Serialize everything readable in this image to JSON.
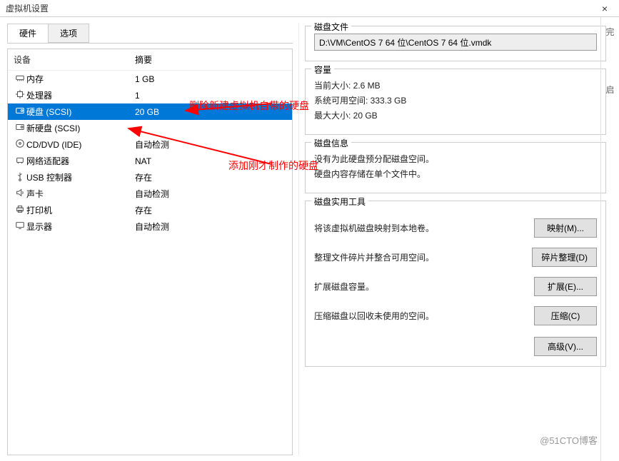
{
  "window": {
    "title": "虚拟机设置",
    "close_icon": "×"
  },
  "tabs": {
    "hardware": "硬件",
    "options": "选项"
  },
  "device_headers": {
    "device": "设备",
    "summary": "摘要"
  },
  "devices": [
    {
      "name": "内存",
      "summary": "1 GB",
      "icon": "memory"
    },
    {
      "name": "处理器",
      "summary": "1",
      "icon": "cpu"
    },
    {
      "name": "硬盘 (SCSI)",
      "summary": "20 GB",
      "icon": "disk",
      "selected": true
    },
    {
      "name": "新硬盘 (SCSI)",
      "summary": "",
      "icon": "disk"
    },
    {
      "name": "CD/DVD (IDE)",
      "summary": "自动检测",
      "icon": "cd"
    },
    {
      "name": "网络适配器",
      "summary": "NAT",
      "icon": "network"
    },
    {
      "name": "USB 控制器",
      "summary": "存在",
      "icon": "usb"
    },
    {
      "name": "声卡",
      "summary": "自动检测",
      "icon": "sound"
    },
    {
      "name": "打印机",
      "summary": "存在",
      "icon": "printer"
    },
    {
      "name": "显示器",
      "summary": "自动检测",
      "icon": "display"
    }
  ],
  "right": {
    "disk_file_title": "磁盘文件",
    "disk_file_path": "D:\\VM\\CentOS 7 64 位\\CentOS 7 64 位.vmdk",
    "capacity_title": "容量",
    "current_size": "当前大小: 2.6 MB",
    "system_avail": "系统可用空间: 333.3 GB",
    "max_size": "最大大小: 20 GB",
    "disk_info_title": "磁盘信息",
    "no_prealloc": "没有为此硬盘预分配磁盘空间。",
    "single_file": "硬盘内容存储在单个文件中。",
    "tools_title": "磁盘实用工具",
    "map_desc": "将该虚拟机磁盘映射到本地卷。",
    "map_btn": "映射(M)...",
    "defrag_desc": "整理文件碎片并整合可用空间。",
    "defrag_btn": "碎片整理(D)",
    "expand_desc": "扩展磁盘容量。",
    "expand_btn": "扩展(E)...",
    "compact_desc": "压缩磁盘以回收未使用的空间。",
    "compact_btn": "压缩(C)",
    "advanced_btn": "高级(V)..."
  },
  "annotations": {
    "delete_text": "删除新建虚拟机自带的硬盘",
    "add_text": "添加刚才制作的硬盘"
  },
  "watermark": "@51CTO博客",
  "side_strip": {
    "t1": "完",
    "t2": "启"
  }
}
